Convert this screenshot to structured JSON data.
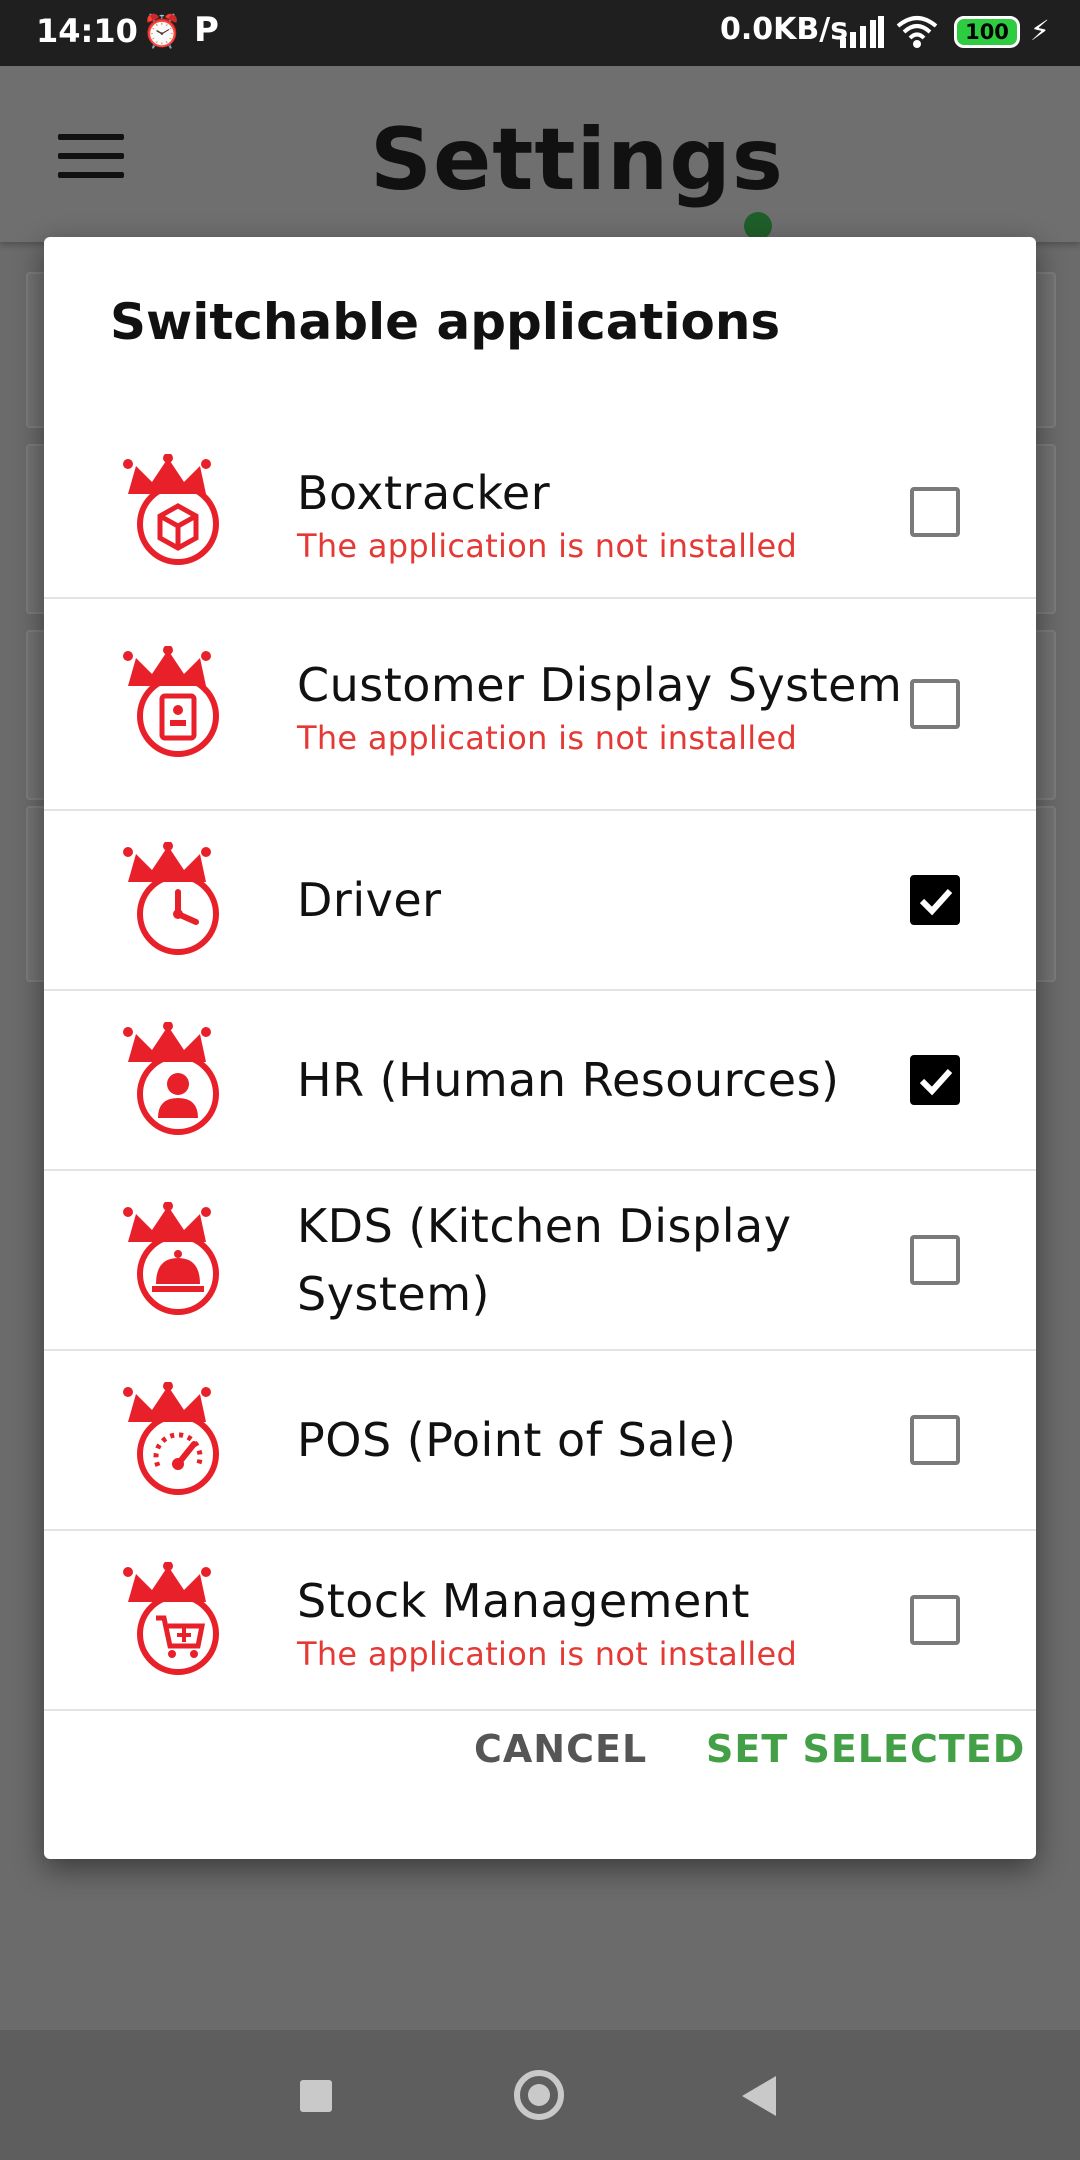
{
  "status_bar": {
    "time": "14:10",
    "network_speed": "0.0KB/s",
    "battery": "100",
    "icons": [
      "alarm-icon",
      "parking-icon",
      "signal-icon",
      "wifi-icon",
      "battery-icon",
      "charging-icon"
    ]
  },
  "app_bar": {
    "title": "Settings",
    "status_dot_color": "#1f5f2a"
  },
  "dialog": {
    "title": "Switchable applications",
    "items": [
      {
        "name": "Boxtracker",
        "warning": "The application is not installed",
        "checked": false,
        "icon": "box-icon"
      },
      {
        "name": "Customer Display System",
        "warning": "The application is not installed",
        "checked": false,
        "icon": "display-icon"
      },
      {
        "name": "Driver",
        "warning": "",
        "checked": true,
        "icon": "clock-icon"
      },
      {
        "name": "HR (Human Resources)",
        "warning": "",
        "checked": true,
        "icon": "person-icon"
      },
      {
        "name": "KDS (Kitchen Display System)",
        "warning": "",
        "checked": false,
        "icon": "cloche-icon"
      },
      {
        "name": "POS (Point of Sale)",
        "warning": "",
        "checked": false,
        "icon": "gauge-icon"
      },
      {
        "name": "Stock Management",
        "warning": "The application is not installed",
        "checked": false,
        "icon": "cart-icon"
      }
    ],
    "cancel_label": "CANCEL",
    "confirm_label": "SET SELECTED"
  },
  "colors": {
    "accent_green": "#43a047",
    "warning_red": "#e53935",
    "brand_red": "#e8202a"
  }
}
